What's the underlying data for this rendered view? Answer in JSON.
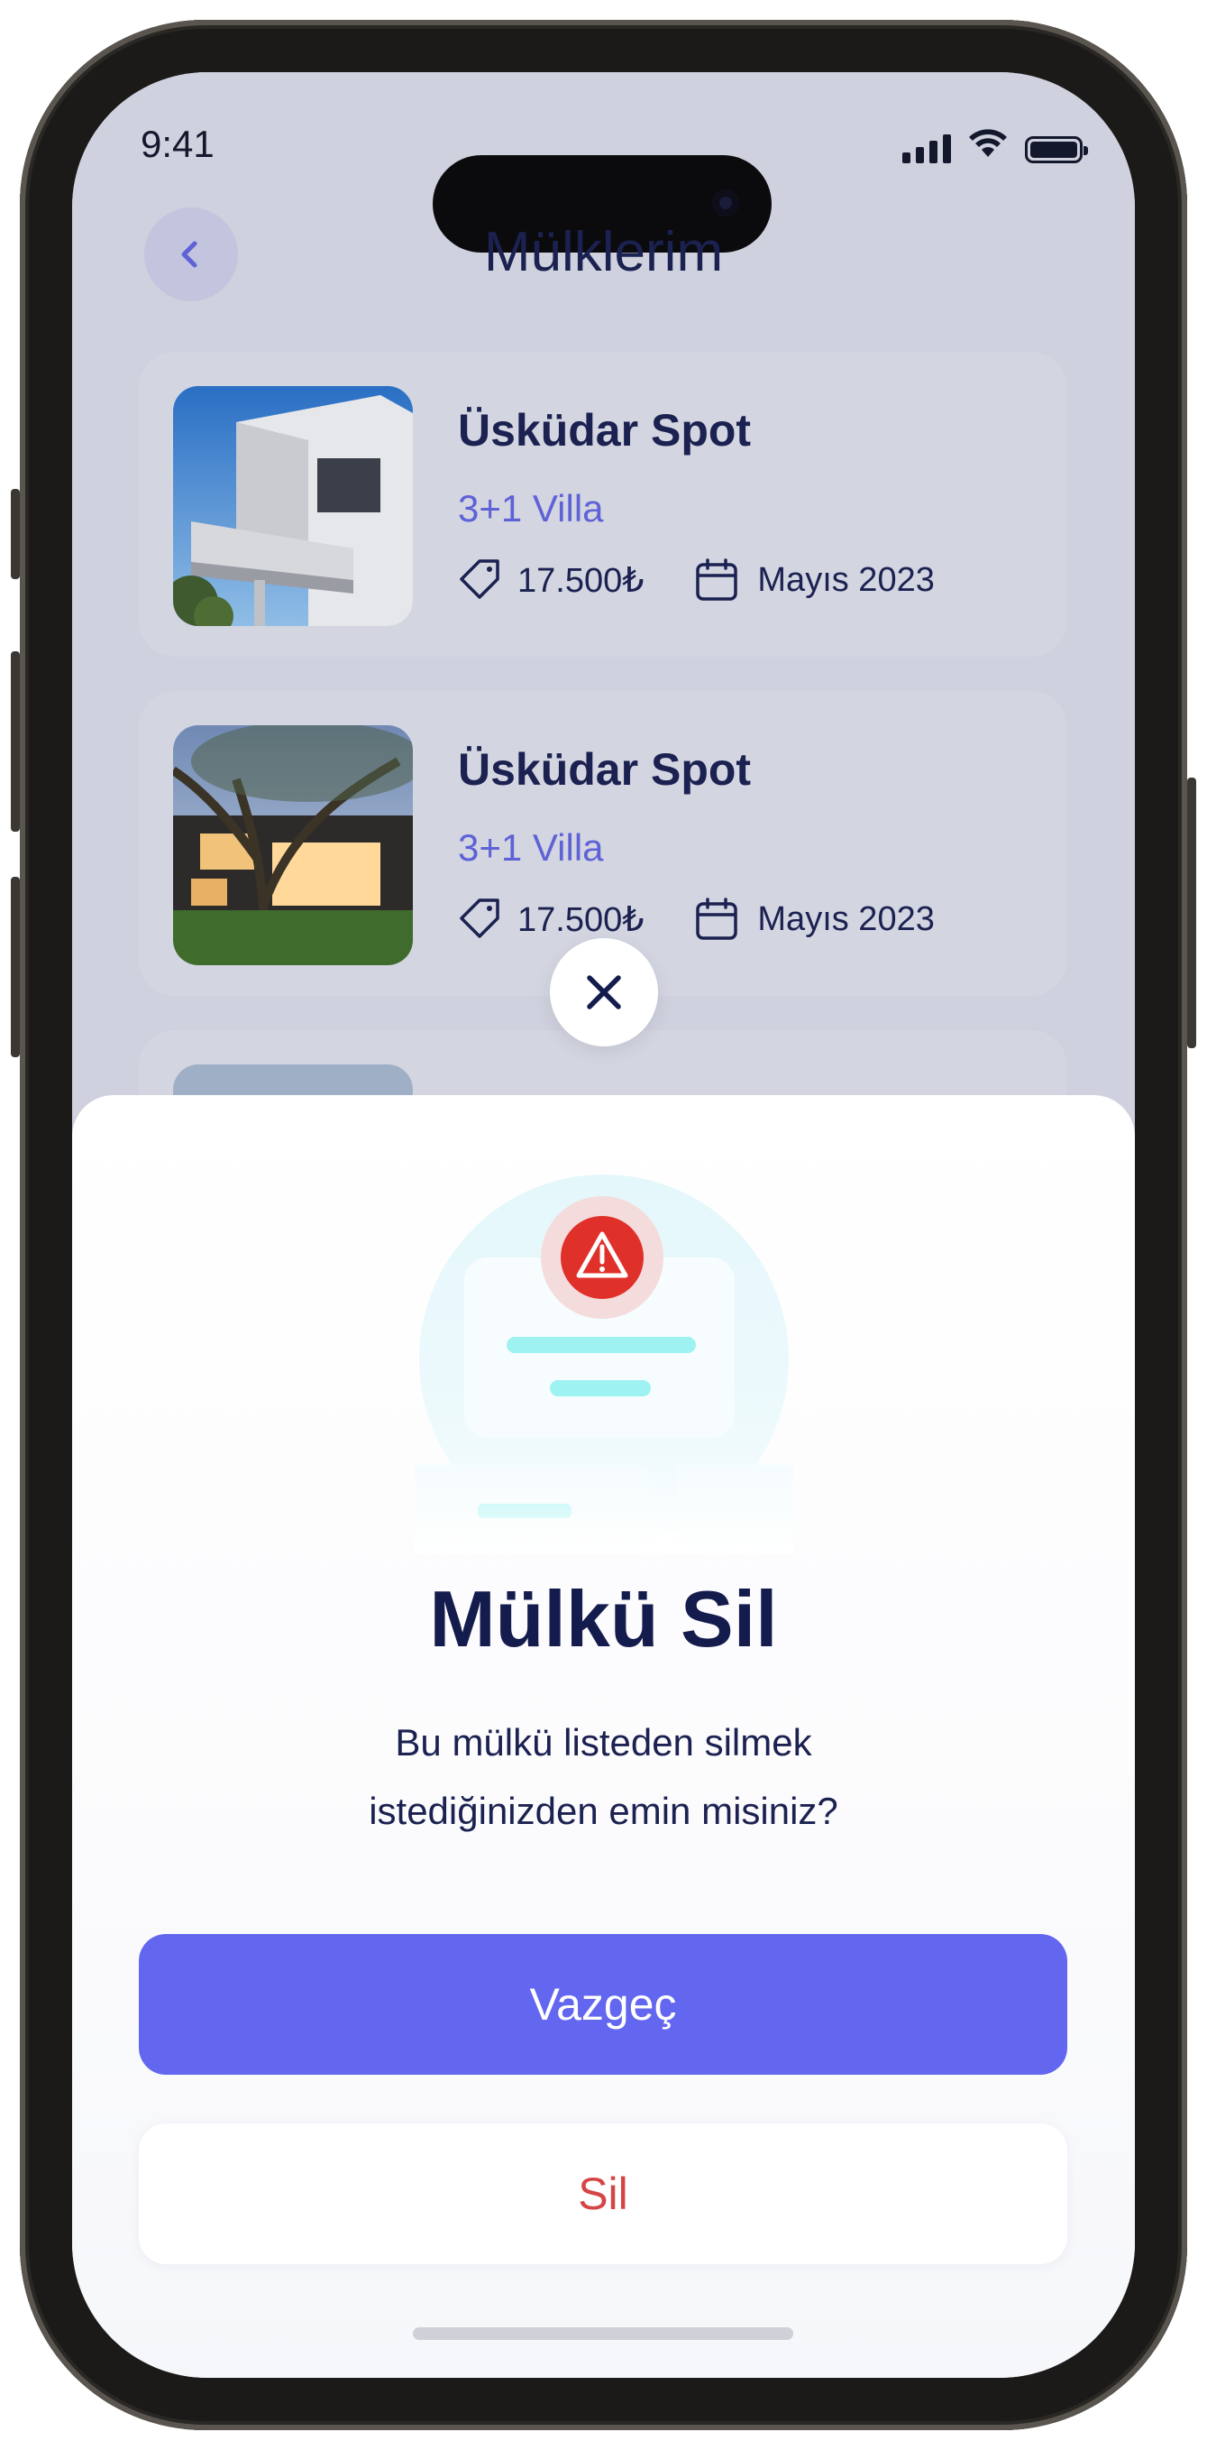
{
  "status_bar": {
    "time": "9:41",
    "icons": [
      "cellular-signal-icon",
      "wifi-icon",
      "battery-icon"
    ]
  },
  "header": {
    "title": "Mülklerim",
    "back_icon": "chevron-left-icon"
  },
  "properties": [
    {
      "name": "Üsküdar Spot",
      "type": "3+1 Villa",
      "price": "17.500₺",
      "date": "Mayıs 2023"
    },
    {
      "name": "Üsküdar Spot",
      "type": "3+1 Villa",
      "price": "17.500₺",
      "date": "Mayıs 2023"
    }
  ],
  "dialog": {
    "title": "Mülkü Sil",
    "message_line1": "Bu mülkü listeden silmek",
    "message_line2": "istediğinizden emin misiniz?",
    "cancel_label": "Vazgeç",
    "delete_label": "Sil",
    "close_icon": "close-icon",
    "illustration_icon": "warning-icon"
  },
  "colors": {
    "accent": "#6366EE",
    "danger": "#D64545",
    "title": "#141B4D",
    "warning": "#E0302A",
    "illustration_cyan": "#9EF2F2"
  }
}
